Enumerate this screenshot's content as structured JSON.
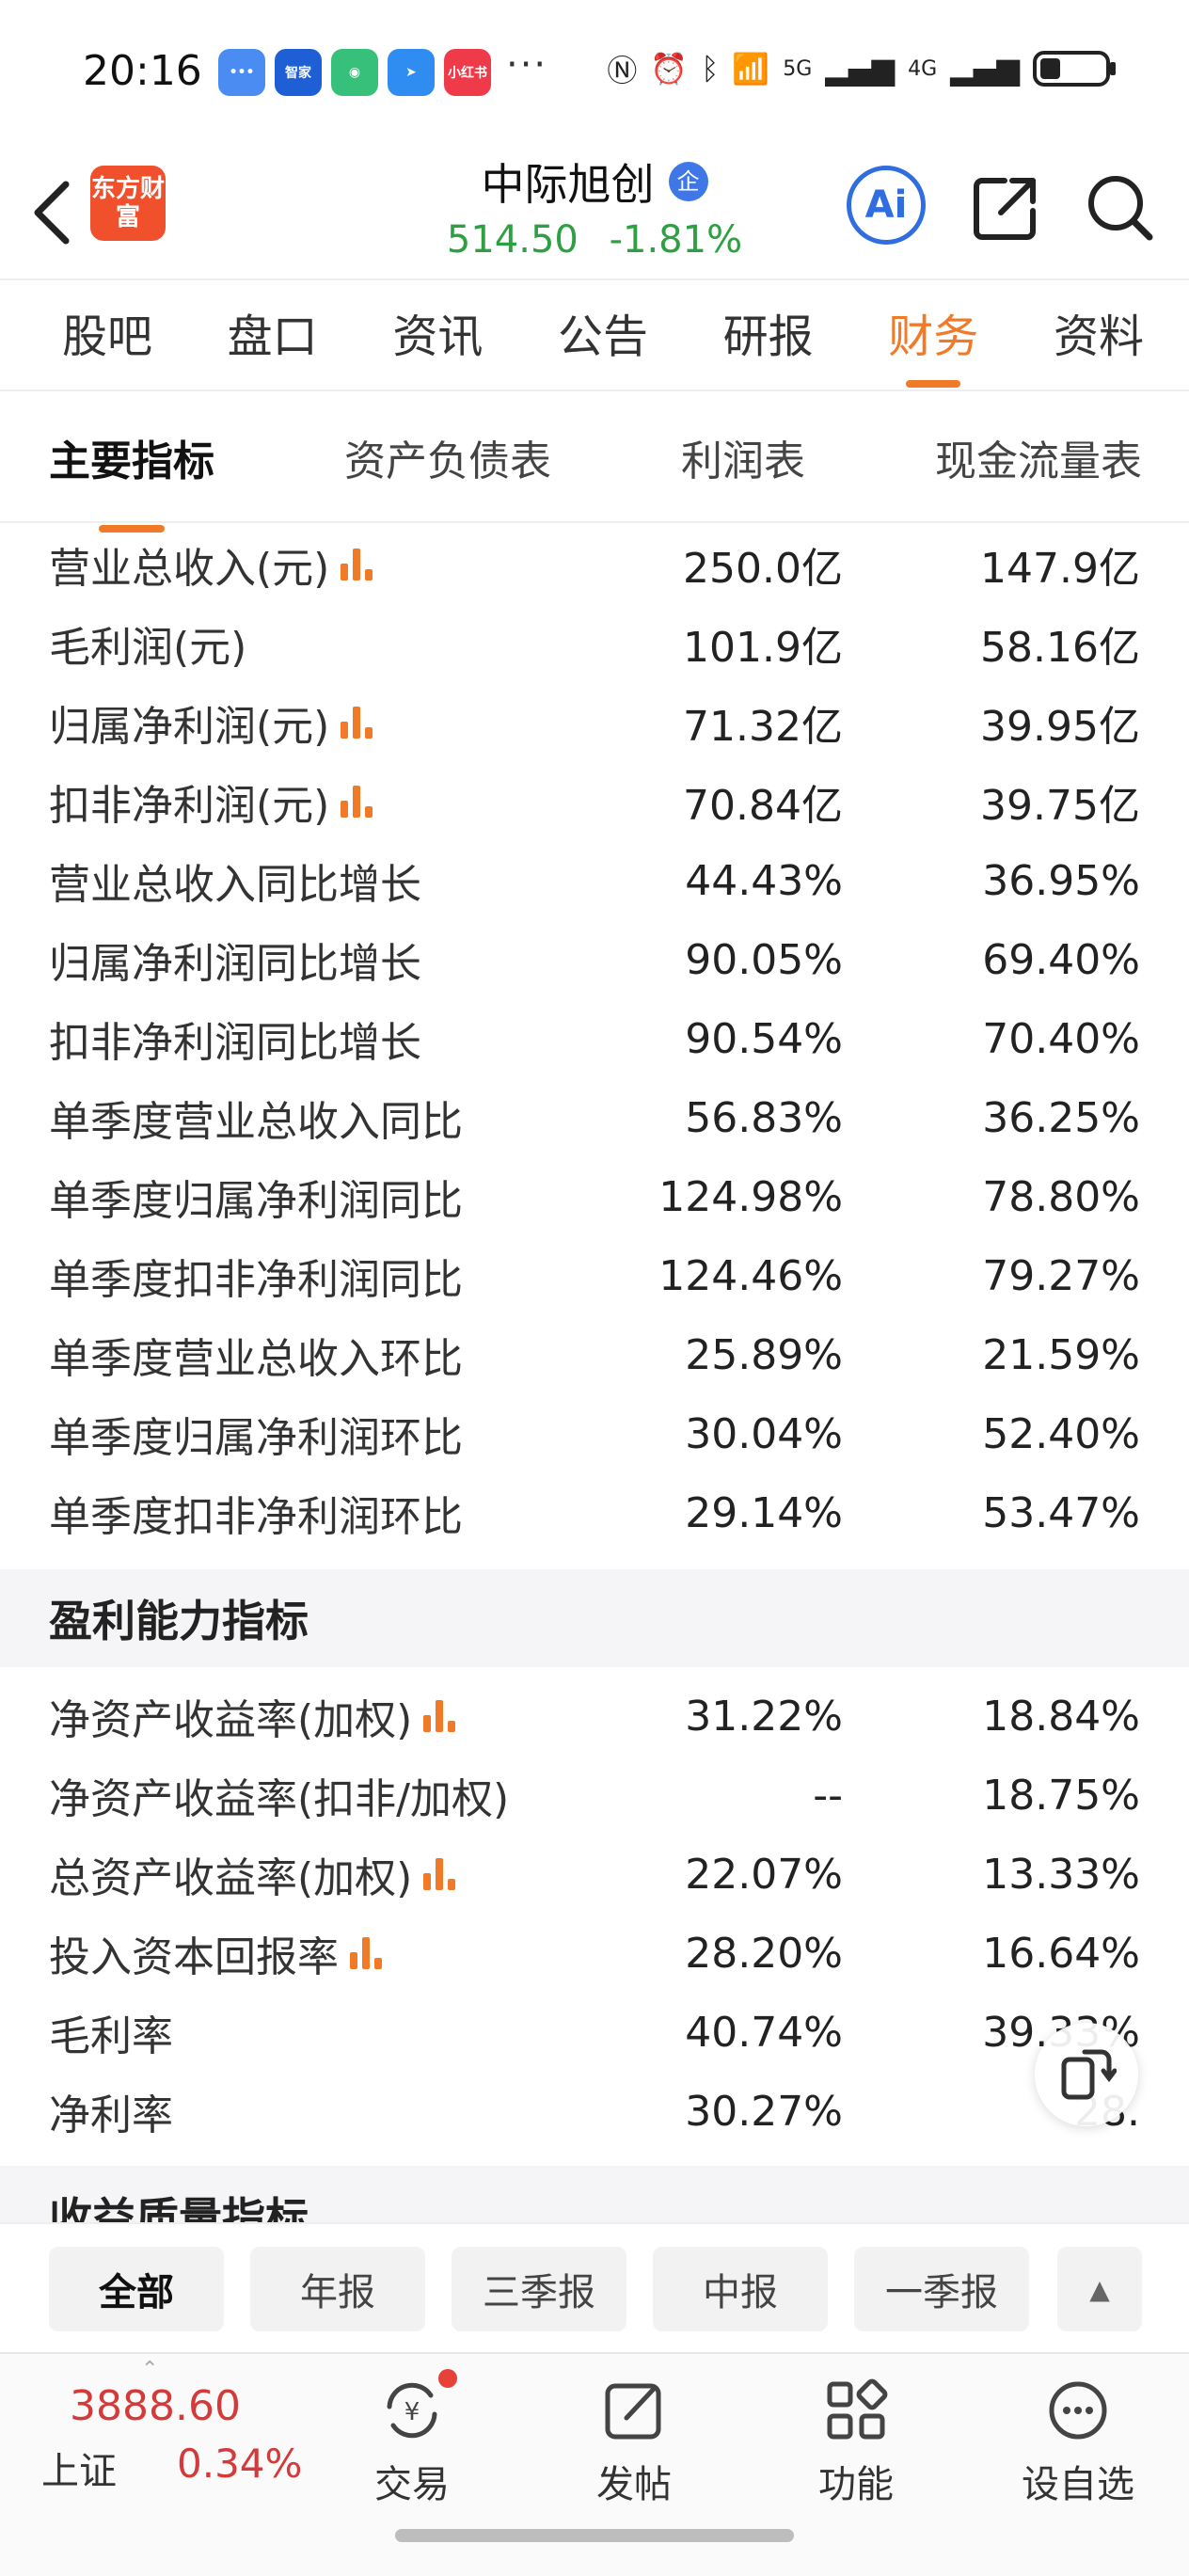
{
  "status_bar": {
    "time": "20:16",
    "apps": [
      "智家",
      "小红书"
    ],
    "more": "···",
    "signal_labels": [
      "5G",
      "4G"
    ]
  },
  "header": {
    "logo_text": "东方财富",
    "title": "中际旭创",
    "badge": "企",
    "price": "514.50",
    "change": "-1.81%",
    "ai_label": "Ai",
    "colors": {
      "down": "#2ea043",
      "accent": "#f07a28",
      "ai": "#2f6de0"
    }
  },
  "tabs": [
    "股吧",
    "盘口",
    "资讯",
    "公告",
    "研报",
    "财务",
    "资料"
  ],
  "active_tab": "财务",
  "subtabs": [
    "主要指标",
    "资产负债表",
    "利润表",
    "现金流量表"
  ],
  "active_subtab": "主要指标",
  "main_rows": [
    {
      "label": "营业总收入(元)",
      "v1": "250.0亿",
      "v2": "147.9亿",
      "chart_icon": true
    },
    {
      "label": "毛利润(元)",
      "v1": "101.9亿",
      "v2": "58.16亿",
      "chart_icon": false
    },
    {
      "label": "归属净利润(元)",
      "v1": "71.32亿",
      "v2": "39.95亿",
      "chart_icon": true
    },
    {
      "label": "扣非净利润(元)",
      "v1": "70.84亿",
      "v2": "39.75亿",
      "chart_icon": true
    },
    {
      "label": "营业总收入同比增长",
      "v1": "44.43%",
      "v2": "36.95%",
      "chart_icon": false
    },
    {
      "label": "归属净利润同比增长",
      "v1": "90.05%",
      "v2": "69.40%",
      "chart_icon": false
    },
    {
      "label": "扣非净利润同比增长",
      "v1": "90.54%",
      "v2": "70.40%",
      "chart_icon": false
    },
    {
      "label": "单季度营业总收入同比",
      "v1": "56.83%",
      "v2": "36.25%",
      "chart_icon": false
    },
    {
      "label": "单季度归属净利润同比",
      "v1": "124.98%",
      "v2": "78.80%",
      "chart_icon": false
    },
    {
      "label": "单季度扣非净利润同比",
      "v1": "124.46%",
      "v2": "79.27%",
      "chart_icon": false
    },
    {
      "label": "单季度营业总收入环比",
      "v1": "25.89%",
      "v2": "21.59%",
      "chart_icon": false
    },
    {
      "label": "单季度归属净利润环比",
      "v1": "30.04%",
      "v2": "52.40%",
      "chart_icon": false
    },
    {
      "label": "单季度扣非净利润环比",
      "v1": "29.14%",
      "v2": "53.47%",
      "chart_icon": false
    }
  ],
  "section_profit": "盈利能力指标",
  "profit_rows": [
    {
      "label": "净资产收益率(加权)",
      "v1": "31.22%",
      "v2": "18.84%",
      "chart_icon": true
    },
    {
      "label": "净资产收益率(扣非/加权)",
      "v1": "--",
      "v2": "18.75%",
      "chart_icon": false
    },
    {
      "label": "总资产收益率(加权)",
      "v1": "22.07%",
      "v2": "13.33%",
      "chart_icon": true
    },
    {
      "label": "投入资本回报率",
      "v1": "28.20%",
      "v2": "16.64%",
      "chart_icon": true
    },
    {
      "label": "毛利率",
      "v1": "40.74%",
      "v2": "39.33%",
      "chart_icon": false
    },
    {
      "label": "净利率",
      "v1": "30.27%",
      "v2": "28.",
      "chart_icon": false
    }
  ],
  "section_quality": "收益质量指标",
  "period_filters": [
    "全部",
    "年报",
    "三季报",
    "中报",
    "一季报"
  ],
  "active_filter": "全部",
  "index": {
    "value": "3888.60",
    "name": "上证",
    "change": "0.34%"
  },
  "bottom_nav": [
    "交易",
    "发帖",
    "功能",
    "设自选"
  ]
}
